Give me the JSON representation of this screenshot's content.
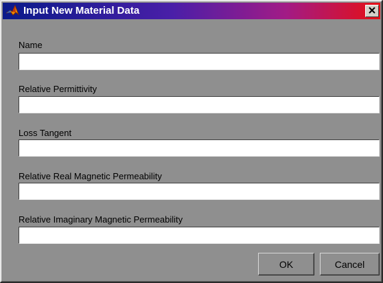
{
  "window": {
    "title": "Input New Material Data",
    "title_icon": "matlab-icon",
    "close_icon": "close-icon",
    "colors": {
      "titlebar_start": "#0a1a8a",
      "titlebar_end": "#e60f14",
      "body": "#8f8f8f"
    }
  },
  "form": {
    "fields": [
      {
        "label": "Name",
        "value": ""
      },
      {
        "label": "Relative Permittivity",
        "value": ""
      },
      {
        "label": "Loss Tangent",
        "value": ""
      },
      {
        "label": "Relative Real Magnetic Permeability",
        "value": ""
      },
      {
        "label": "Relative Imaginary Magnetic Permeability",
        "value": ""
      }
    ]
  },
  "buttons": {
    "ok_label": "OK",
    "cancel_label": "Cancel"
  }
}
